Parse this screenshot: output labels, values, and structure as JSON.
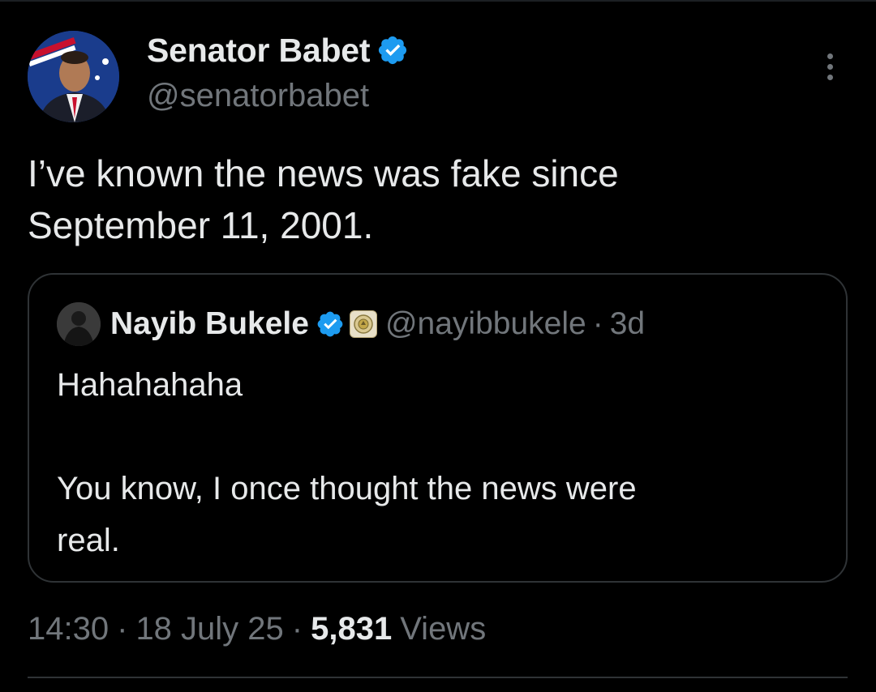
{
  "tweet": {
    "author": {
      "display_name": "Senator Babet",
      "handle": "@senatorbabet",
      "avatar_icon": "senator-avatar",
      "verified": true
    },
    "text": "I’ve known the news was fake since\nSeptember 11, 2001.",
    "meta": {
      "time": "14:30",
      "date": "18 July 25",
      "views_count": "5,831",
      "views_label": "Views"
    }
  },
  "quote": {
    "author": {
      "display_name": "Nayib Bukele",
      "handle": "@nayibbukele",
      "avatar_icon": "nayib-avatar",
      "verified": true,
      "affiliation_icon": "government-seal-icon"
    },
    "time_ago": "3d",
    "text": "Hahahahaha\n\nYou know, I once thought the news were\nreal."
  },
  "theme": {
    "background": "#000000",
    "text_primary": "#e7e9ea",
    "text_secondary": "#71767b",
    "border": "#2f3336",
    "verified_blue": "#1d9bf0"
  }
}
